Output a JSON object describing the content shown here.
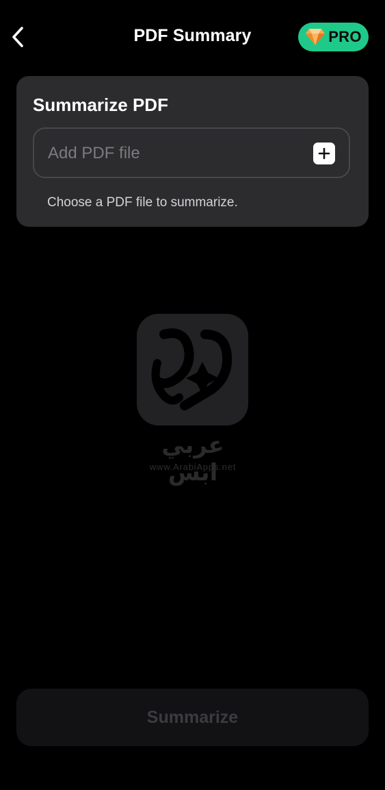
{
  "header": {
    "title": "PDF Summary",
    "back_icon": "chevron-left-icon",
    "pro_badge": {
      "label": "PRO",
      "icon": "diamond-icon",
      "color": "#1fc98a"
    }
  },
  "card": {
    "title": "Summarize PDF",
    "file_input": {
      "placeholder": "Add PDF file",
      "add_icon": "plus-icon"
    },
    "hint": "Choose a PDF file to summarize."
  },
  "watermark": {
    "arabic_text": "عربي ابس",
    "url": "www.ArabiApps.net"
  },
  "actions": {
    "summarize_label": "Summarize",
    "summarize_enabled": false
  }
}
